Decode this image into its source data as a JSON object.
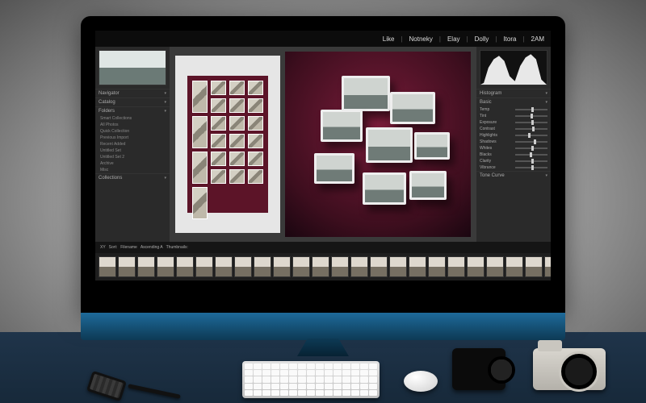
{
  "nav": {
    "items": [
      "Like",
      "Notneky",
      "Elay",
      "Dolly",
      "Itora",
      "2AM"
    ]
  },
  "left": {
    "sections": [
      {
        "label": "Navigator"
      },
      {
        "label": "Catalog"
      },
      {
        "label": "Folders"
      },
      {
        "label": "Collections"
      }
    ],
    "subitems": [
      "Smart Collections",
      "All Photos",
      "Quick Collection",
      "Previous Import",
      "Recent Added",
      "Untitled Set",
      "Untitled Set 2",
      "Archive",
      "Misc"
    ]
  },
  "right": {
    "sections": [
      {
        "label": "Histogram"
      },
      {
        "label": "Basic"
      },
      {
        "label": "Tone Curve"
      }
    ],
    "sliders": [
      {
        "label": "Temp",
        "pos": 50
      },
      {
        "label": "Tint",
        "pos": 48
      },
      {
        "label": "Exposure",
        "pos": 50
      },
      {
        "label": "Contrast",
        "pos": 52
      },
      {
        "label": "Highlights",
        "pos": 40
      },
      {
        "label": "Shadows",
        "pos": 58
      },
      {
        "label": "Whites",
        "pos": 50
      },
      {
        "label": "Blacks",
        "pos": 46
      },
      {
        "label": "Clarity",
        "pos": 50
      },
      {
        "label": "Vibrance",
        "pos": 50
      }
    ]
  },
  "toolbar": {
    "items": [
      "XY",
      "Sort:",
      "Filename",
      "Ascending A",
      "Thumbnails:"
    ]
  },
  "filmstrip": {
    "count": 24
  },
  "board1": {
    "count": 22
  },
  "colors": {
    "maroon": "#5c1428"
  }
}
